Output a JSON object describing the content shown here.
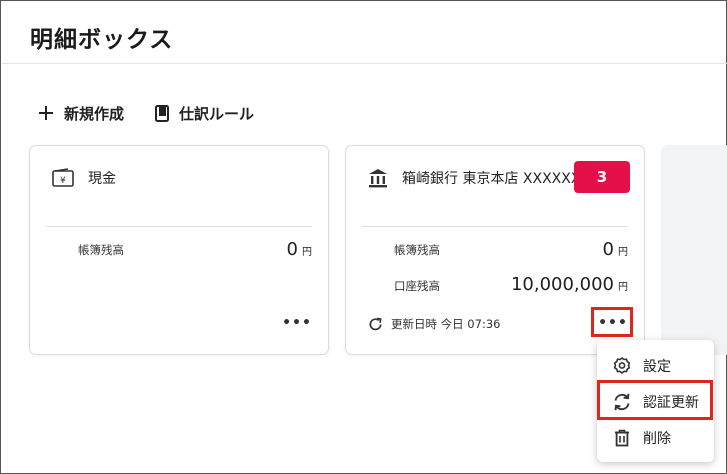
{
  "page": {
    "title": "明細ボックス"
  },
  "toolbar": {
    "new_label": "新規作成",
    "journal_rules_label": "仕訳ルール"
  },
  "cards": [
    {
      "title": "現金",
      "book_balance_label": "帳簿残高",
      "book_balance_value": "0",
      "book_balance_unit": "円"
    },
    {
      "title": "箱崎銀行 東京本店 XXXXXXX",
      "badge": "3",
      "book_balance_label": "帳簿残高",
      "book_balance_value": "0",
      "book_balance_unit": "円",
      "account_balance_label": "口座残高",
      "account_balance_value": "10,000,000",
      "account_balance_unit": "円",
      "updated_label": "更新日時 今日 07:36"
    }
  ],
  "menu": {
    "items": [
      {
        "label": "設定",
        "icon": "gear-icon"
      },
      {
        "label": "認証更新",
        "icon": "refresh-icon"
      },
      {
        "label": "削除",
        "icon": "trash-icon"
      }
    ]
  },
  "colors": {
    "badge": "#e5104a",
    "highlight": "#e0261b"
  }
}
